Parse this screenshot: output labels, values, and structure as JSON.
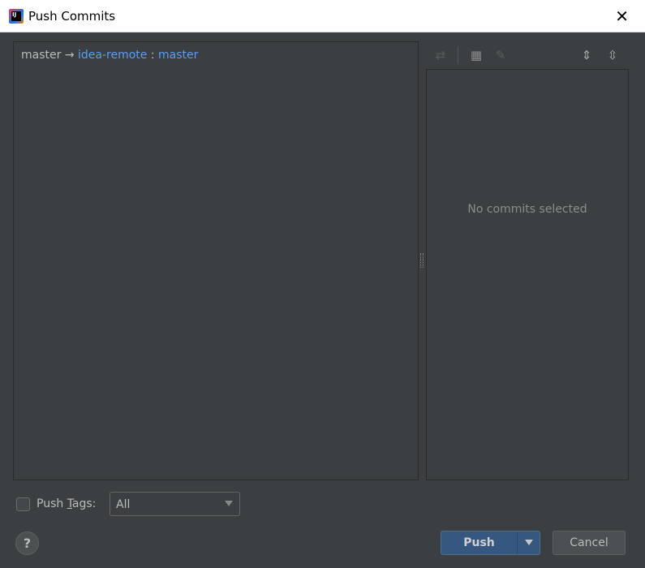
{
  "window": {
    "title": "Push Commits",
    "close_icon": "close-icon"
  },
  "branch": {
    "local": "master",
    "arrow": "→",
    "remote": "idea-remote",
    "separator": ":",
    "remote_branch": "master"
  },
  "toolbar": {
    "icons": [
      "cherry-pick-icon",
      "group-by-icon",
      "edit-icon",
      "expand-all-icon",
      "collapse-all-icon"
    ]
  },
  "details": {
    "empty_text": "No commits selected"
  },
  "tags": {
    "checked": false,
    "label_pre": "Push ",
    "label_mnemonic": "T",
    "label_post": "ags:",
    "selected": "All"
  },
  "buttons": {
    "help": "?",
    "push": "Push",
    "cancel": "Cancel"
  },
  "colors": {
    "background": "#3c3f41",
    "link": "#589df6",
    "primary": "#365880"
  }
}
